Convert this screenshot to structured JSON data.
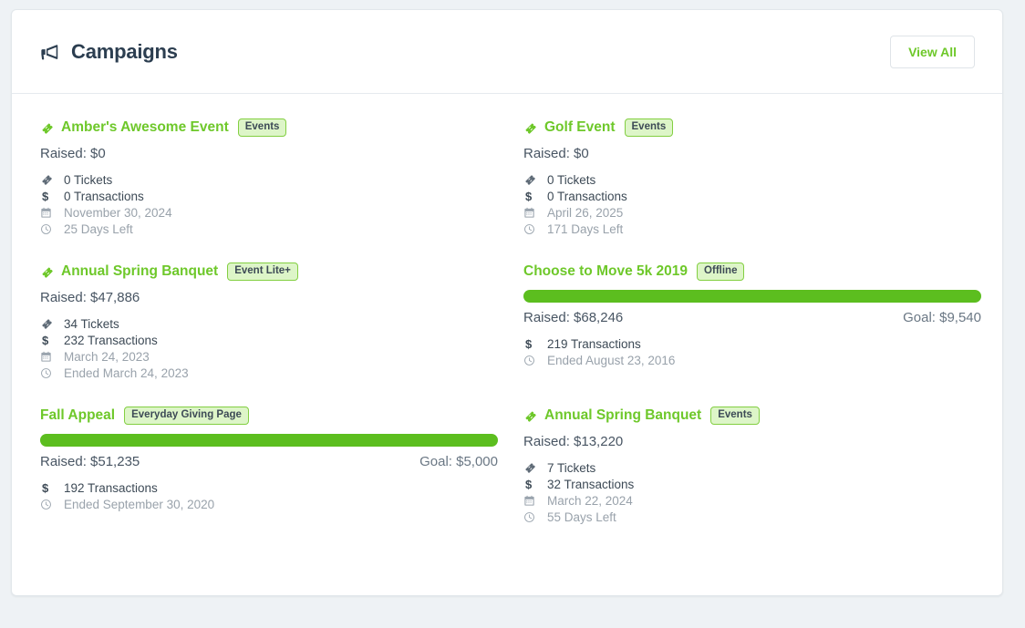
{
  "header": {
    "title": "Campaigns",
    "icon": "bullhorn-icon",
    "view_all_label": "View All"
  },
  "colors": {
    "accent_green": "#6ec82a",
    "progress_green": "#5cbe1f",
    "badge_bg": "#ddf5c8",
    "badge_border": "#83cf42",
    "title_dark": "#2c3e50",
    "muted": "#99a2ab",
    "page_bg": "#eef2f5"
  },
  "labels": {
    "tickets_icon": "ticket-icon",
    "transactions_icon": "dollar-icon",
    "date_icon": "calendar-icon",
    "time_icon": "clock-icon"
  },
  "campaigns": [
    {
      "id": "ambers-awesome-event",
      "title": "Amber's Awesome Event",
      "has_title_icon": true,
      "badge": "Events",
      "raised": "Raised: $0",
      "goal": null,
      "progress_percent": null,
      "stats": [
        {
          "icon": "ticket-icon",
          "text": "0 Tickets",
          "muted": false
        },
        {
          "icon": "dollar-icon",
          "text": "0 Transactions",
          "muted": false
        },
        {
          "icon": "calendar-icon",
          "text": "November 30, 2024",
          "muted": true
        },
        {
          "icon": "clock-icon",
          "text": "25 Days Left",
          "muted": true
        }
      ]
    },
    {
      "id": "golf-event",
      "title": "Golf Event",
      "has_title_icon": true,
      "badge": "Events",
      "raised": "Raised: $0",
      "goal": null,
      "progress_percent": null,
      "stats": [
        {
          "icon": "ticket-icon",
          "text": "0 Tickets",
          "muted": false
        },
        {
          "icon": "dollar-icon",
          "text": "0 Transactions",
          "muted": false
        },
        {
          "icon": "calendar-icon",
          "text": "April 26, 2025",
          "muted": true
        },
        {
          "icon": "clock-icon",
          "text": "171 Days Left",
          "muted": true
        }
      ]
    },
    {
      "id": "annual-spring-banquet-2023",
      "title": "Annual Spring Banquet",
      "has_title_icon": true,
      "badge": "Event Lite+",
      "raised": "Raised: $47,886",
      "goal": null,
      "progress_percent": null,
      "stats": [
        {
          "icon": "ticket-icon",
          "text": "34 Tickets",
          "muted": false
        },
        {
          "icon": "dollar-icon",
          "text": "232 Transactions",
          "muted": false
        },
        {
          "icon": "calendar-icon",
          "text": "March 24, 2023",
          "muted": true
        },
        {
          "icon": "clock-icon",
          "text": "Ended March 24, 2023",
          "muted": true
        }
      ]
    },
    {
      "id": "choose-to-move-5k-2019",
      "title": "Choose to Move 5k 2019",
      "has_title_icon": false,
      "badge": "Offline",
      "raised": "Raised: $68,246",
      "goal": "Goal: $9,540",
      "progress_percent": 100,
      "stats": [
        {
          "icon": "dollar-icon",
          "text": "219 Transactions",
          "muted": false
        },
        {
          "icon": "clock-icon",
          "text": "Ended August 23, 2016",
          "muted": true
        }
      ]
    },
    {
      "id": "fall-appeal",
      "title": "Fall Appeal",
      "has_title_icon": false,
      "badge": "Everyday Giving Page",
      "raised": "Raised: $51,235",
      "goal": "Goal: $5,000",
      "progress_percent": 100,
      "stats": [
        {
          "icon": "dollar-icon",
          "text": "192 Transactions",
          "muted": false
        },
        {
          "icon": "clock-icon",
          "text": "Ended September 30, 2020",
          "muted": true
        }
      ]
    },
    {
      "id": "annual-spring-banquet-2024",
      "title": "Annual Spring Banquet",
      "has_title_icon": true,
      "badge": "Events",
      "raised": "Raised: $13,220",
      "goal": null,
      "progress_percent": null,
      "stats": [
        {
          "icon": "ticket-icon",
          "text": "7 Tickets",
          "muted": false
        },
        {
          "icon": "dollar-icon",
          "text": "32 Transactions",
          "muted": false
        },
        {
          "icon": "calendar-icon",
          "text": "March 22, 2024",
          "muted": true
        },
        {
          "icon": "clock-icon",
          "text": "55 Days Left",
          "muted": true
        }
      ]
    }
  ]
}
